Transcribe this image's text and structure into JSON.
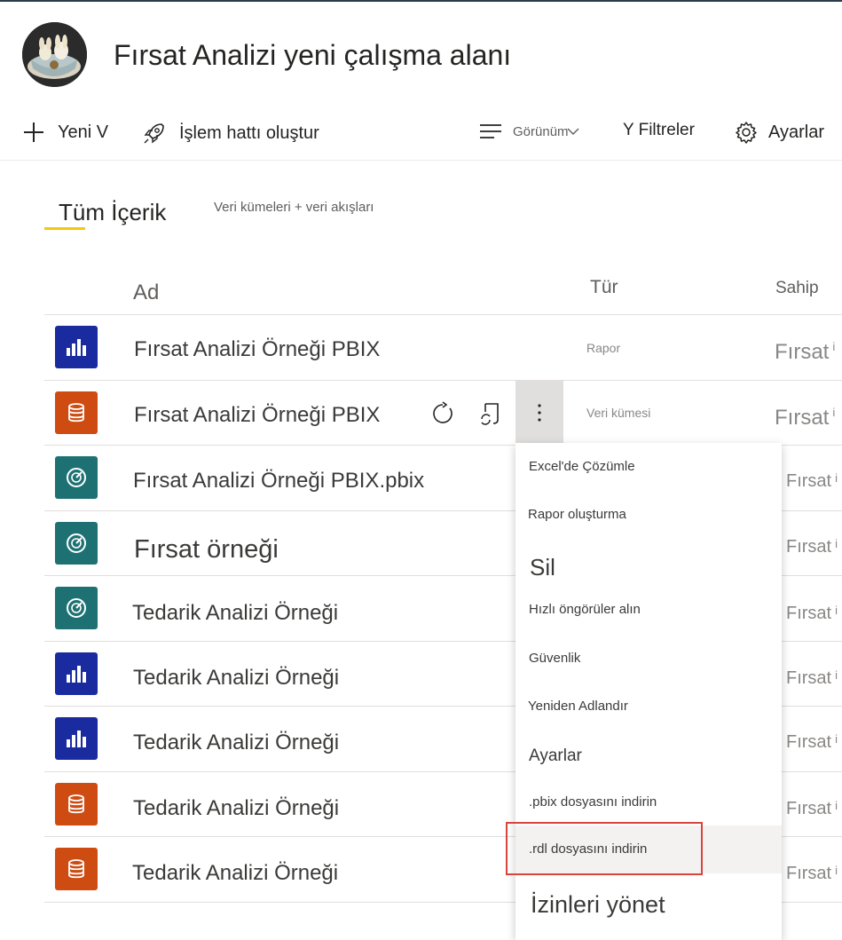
{
  "workspace": {
    "title": "Fırsat Analizi yeni çalışma alanı",
    "avatar_icon": "workspace-avatar-image"
  },
  "toolbar": {
    "new_label": "Yeni V",
    "pipeline_label": "İşlem hattı oluştur",
    "view_label": "Görünüm",
    "filter_label": "Y Filtreler",
    "settings_label": "Ayarlar"
  },
  "tabs": {
    "all_content": "Tüm İçerik",
    "datasets": "Veri kümeleri + veri akışları",
    "active_accent": "#f2c811"
  },
  "columns": {
    "name": "Ad",
    "type": "Tür",
    "owner": "Sahip"
  },
  "rows": [
    {
      "icon": "report-icon",
      "name": "Fırsat Analizi Örneği PBIX",
      "type": "Rapor",
      "owner": "Fırsat"
    },
    {
      "icon": "dataset-icon",
      "name": "Fırsat Analizi Örneği PBIX",
      "type": "Veri kümesi",
      "owner": "Fırsat"
    },
    {
      "icon": "dashboard-icon",
      "name": "Fırsat Analizi Örneği PBIX.pbix",
      "type": "",
      "owner": "Fırsat"
    },
    {
      "icon": "dashboard-icon",
      "name": "Fırsat örneği",
      "type": "",
      "owner": "Fırsat"
    },
    {
      "icon": "dashboard-icon",
      "name": "Tedarik Analizi Örneği",
      "type": "",
      "owner": "Fırsat"
    },
    {
      "icon": "report-icon",
      "name": "Tedarik Analizi Örneği",
      "type": "",
      "owner": "Fırsat"
    },
    {
      "icon": "report-icon",
      "name": "Tedarik Analizi Örneği",
      "type": "",
      "owner": "Fırsat"
    },
    {
      "icon": "dataset-icon",
      "name": "Tedarik Analizi Örneği",
      "type": "",
      "owner": "Fırsat"
    },
    {
      "icon": "dataset-icon",
      "name": "Tedarik Analizi Örneği",
      "type": "",
      "owner": "Fırsat"
    }
  ],
  "row_info_glyph": "i",
  "context_menu": {
    "items": [
      "Excel'de Çözümle",
      "Rapor oluşturma",
      "Sil",
      "Hızlı öngörüler alın",
      "Güvenlik",
      "Yeniden Adlandır",
      "Ayarlar",
      ".pbix dosyasını indirin",
      ".rdl dosyasını indirin",
      "İzinleri yönet"
    ],
    "highlighted_item": ".rdl dosyasını indirin",
    "highlight_color": "#d9443c"
  },
  "colors": {
    "report": "#1a2ba0",
    "dataset": "#ce4c12",
    "dashboard": "#1e7173"
  }
}
